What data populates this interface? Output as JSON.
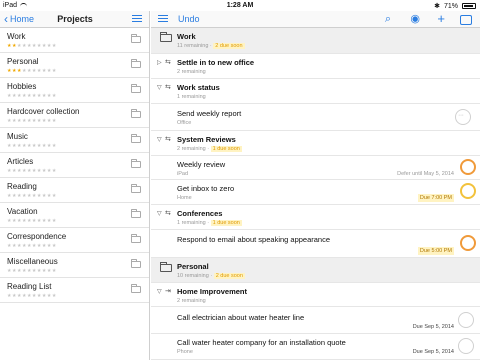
{
  "status_bar": {
    "device": "iPad",
    "time": "1:28 AM",
    "battery": "71%"
  },
  "left": {
    "back_label": "Home",
    "title": "Projects",
    "projects": [
      {
        "name": "Work",
        "stars": 2
      },
      {
        "name": "Personal",
        "stars": 3
      },
      {
        "name": "Hobbies",
        "stars": 0
      },
      {
        "name": "Hardcover collection",
        "stars": 0
      },
      {
        "name": "Music",
        "stars": 0
      },
      {
        "name": "Articles",
        "stars": 0
      },
      {
        "name": "Reading",
        "stars": 0
      },
      {
        "name": "Vacation",
        "stars": 0
      },
      {
        "name": "Correspondence",
        "stars": 0
      },
      {
        "name": "Miscellaneous",
        "stars": 0
      },
      {
        "name": "Reading List",
        "stars": 0
      }
    ]
  },
  "right": {
    "undo_label": "Undo",
    "toolbar_icons": [
      "search-icon",
      "eye-icon",
      "plus-icon",
      "inbox-icon"
    ],
    "rows": {
      "work": {
        "title": "Work",
        "remaining": "11 remaining",
        "due": "2 due soon"
      },
      "settle": {
        "title": "Settle in to new office",
        "remaining": "2 remaining"
      },
      "work_status": {
        "title": "Work status",
        "remaining": "1 remaining"
      },
      "weekly_report": {
        "title": "Send weekly report",
        "context": "Office"
      },
      "system_reviews": {
        "title": "System Reviews",
        "remaining": "2 remaining",
        "due": "1 due soon"
      },
      "weekly_review": {
        "title": "Weekly review",
        "context": "iPad",
        "defer": "Defer until May 5, 2014"
      },
      "inbox_zero": {
        "title": "Get inbox to zero",
        "context": "Home",
        "due": "Due 7:00 PM"
      },
      "conferences": {
        "title": "Conferences",
        "remaining": "1 remaining",
        "due": "1 due soon"
      },
      "respond_email": {
        "title": "Respond to email about speaking appearance",
        "due": "Due 5:00 PM"
      },
      "personal": {
        "title": "Personal",
        "remaining": "10 remaining",
        "due": "2 due soon"
      },
      "home_improvement": {
        "title": "Home Improvement",
        "remaining": "2 remaining"
      },
      "call_electrician": {
        "title": "Call electrician about water heater line",
        "due": "Due Sep 5, 2014"
      },
      "call_water_company": {
        "title": "Call water heater company for an installation quote",
        "context": "Phone",
        "due": "Due Sep 5, 2014"
      }
    }
  },
  "colors": {
    "accent": "#2a7de1",
    "due_bg": "#fff3c2",
    "orange_circle": "#f09a3a",
    "yellow_circle": "#f2c23c"
  }
}
